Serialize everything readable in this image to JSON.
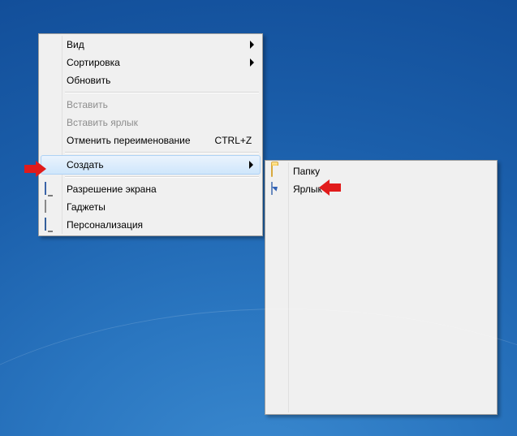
{
  "context_menu": {
    "view": {
      "label": "Вид",
      "has_submenu": true
    },
    "sort": {
      "label": "Сортировка",
      "has_submenu": true
    },
    "refresh": {
      "label": "Обновить"
    },
    "paste": {
      "label": "Вставить",
      "disabled": true
    },
    "paste_short": {
      "label": "Вставить ярлык",
      "disabled": true
    },
    "undo_rename": {
      "label": "Отменить переименование",
      "shortcut": "CTRL+Z"
    },
    "new": {
      "label": "Создать",
      "has_submenu": true,
      "highlighted": true
    },
    "resolution": {
      "label": "Разрешение экрана",
      "icon": "display-icon"
    },
    "gadgets": {
      "label": "Гаджеты",
      "icon": "gadgets-icon"
    },
    "personalize": {
      "label": "Персонализация",
      "icon": "personal-icon"
    }
  },
  "new_submenu": {
    "folder": {
      "label": "Папку",
      "icon": "folder-icon"
    },
    "shortcut": {
      "label": "Ярлык",
      "icon": "shortcut-icon"
    }
  },
  "annotations": {
    "arrow_to_new": "red-arrow-right",
    "arrow_to_shortcut": "red-arrow-left"
  }
}
